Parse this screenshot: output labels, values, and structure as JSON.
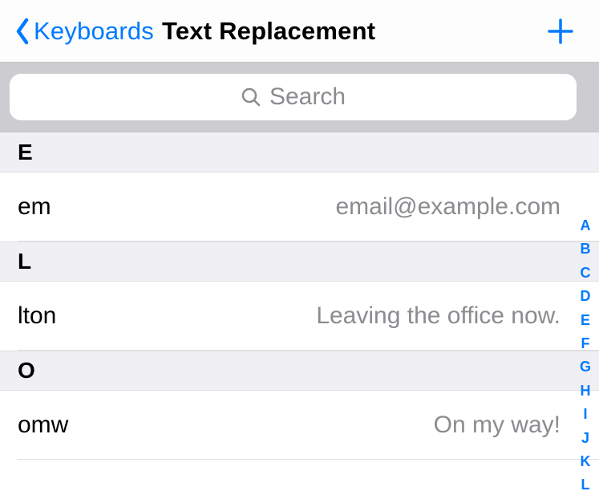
{
  "nav": {
    "back_label": "Keyboards",
    "title": "Text Replacement"
  },
  "search": {
    "placeholder": "Search"
  },
  "sections": [
    {
      "letter": "E",
      "items": [
        {
          "shortcut": "em",
          "phrase": "email@example.com"
        }
      ]
    },
    {
      "letter": "L",
      "items": [
        {
          "shortcut": "lton",
          "phrase": "Leaving the office now."
        }
      ]
    },
    {
      "letter": "O",
      "items": [
        {
          "shortcut": "omw",
          "phrase": "On my way!"
        }
      ]
    }
  ],
  "index_letters": [
    "A",
    "B",
    "C",
    "D",
    "E",
    "F",
    "G",
    "H",
    "I",
    "J",
    "K",
    "L"
  ],
  "colors": {
    "accent": "#007aff",
    "secondary_text": "#8b8b90",
    "section_bg": "#efeff4",
    "search_bg": "#cdcdd1"
  }
}
